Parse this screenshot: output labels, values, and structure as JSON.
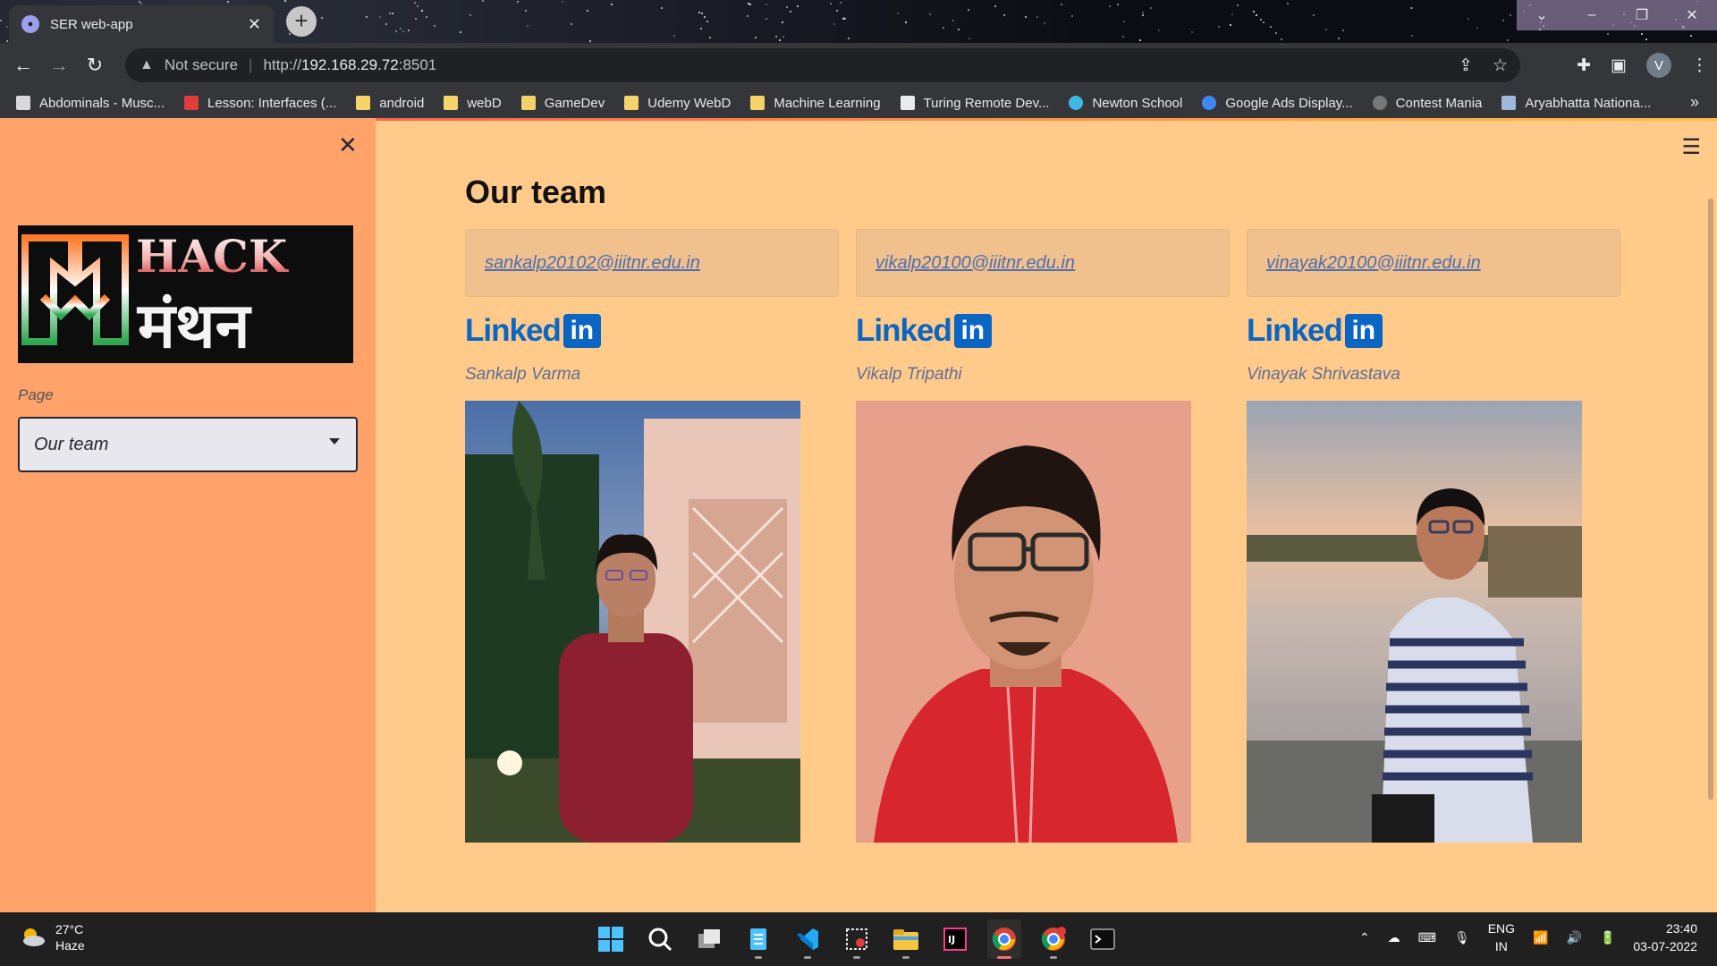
{
  "browser": {
    "tab_title": "SER web-app",
    "url_warning": "Not secure",
    "url_prefix": "http://",
    "url_host": "192.168.29.72",
    "url_port": ":8501",
    "profile_initial": "V"
  },
  "bookmarks": [
    {
      "label": "Abdominals - Musc...",
      "icon": "muscle-icon",
      "color": "#d9d9d9"
    },
    {
      "label": "Lesson: Interfaces (...",
      "icon": "oracle-icon",
      "color": "#e03c3c"
    },
    {
      "label": "android",
      "icon": "folder-icon",
      "color": "#f5d36b"
    },
    {
      "label": "webD",
      "icon": "folder-icon",
      "color": "#f5d36b"
    },
    {
      "label": "GameDev",
      "icon": "folder-icon",
      "color": "#f5d36b"
    },
    {
      "label": "Udemy WebD",
      "icon": "folder-icon",
      "color": "#f5d36b"
    },
    {
      "label": "Machine Learning",
      "icon": "folder-icon",
      "color": "#f5d36b"
    },
    {
      "label": "Turing Remote Dev...",
      "icon": "turing-icon",
      "color": "#e8eaed"
    },
    {
      "label": "Newton School",
      "icon": "newton-icon",
      "color": "#3fb8e8"
    },
    {
      "label": "Google Ads Display...",
      "icon": "google-icon",
      "color": "#4285f4"
    },
    {
      "label": "Contest Mania",
      "icon": "code-icon",
      "color": "#777777"
    },
    {
      "label": "Aryabhatta Nationa...",
      "icon": "aryabhatta-icon",
      "color": "#9fb7d9"
    }
  ],
  "bookmarks_more": "»",
  "sidebar": {
    "close": "✕",
    "logo_text_top": "HACK",
    "logo_text_bottom": "मंथन",
    "page_label": "Page",
    "page_select_value": "Our team"
  },
  "main": {
    "title": "Our team",
    "members": [
      {
        "email": "sankalp20102@iiitnr.edu.in",
        "name": "Sankalp Varma",
        "linkedin_text": "Linked",
        "linkedin_box": "in"
      },
      {
        "email": "vikalp20100@iiitnr.edu.in",
        "name": "Vikalp Tripathi",
        "linkedin_text": "Linked",
        "linkedin_box": "in"
      },
      {
        "email": "vinayak20100@iiitnr.edu.in",
        "name": "Vinayak Shrivastava",
        "linkedin_text": "Linked",
        "linkedin_box": "in"
      }
    ]
  },
  "taskbar": {
    "temp": "27°C",
    "weather": "Haze",
    "lang_top": "ENG",
    "lang_bottom": "IN",
    "time": "23:40",
    "date": "03-07-2022"
  },
  "colors": {
    "sidebar_bg": "#ffa36b",
    "main_bg": "#ffca8a",
    "link": "#4f6fb0",
    "linkedin": "#0a66c2"
  }
}
